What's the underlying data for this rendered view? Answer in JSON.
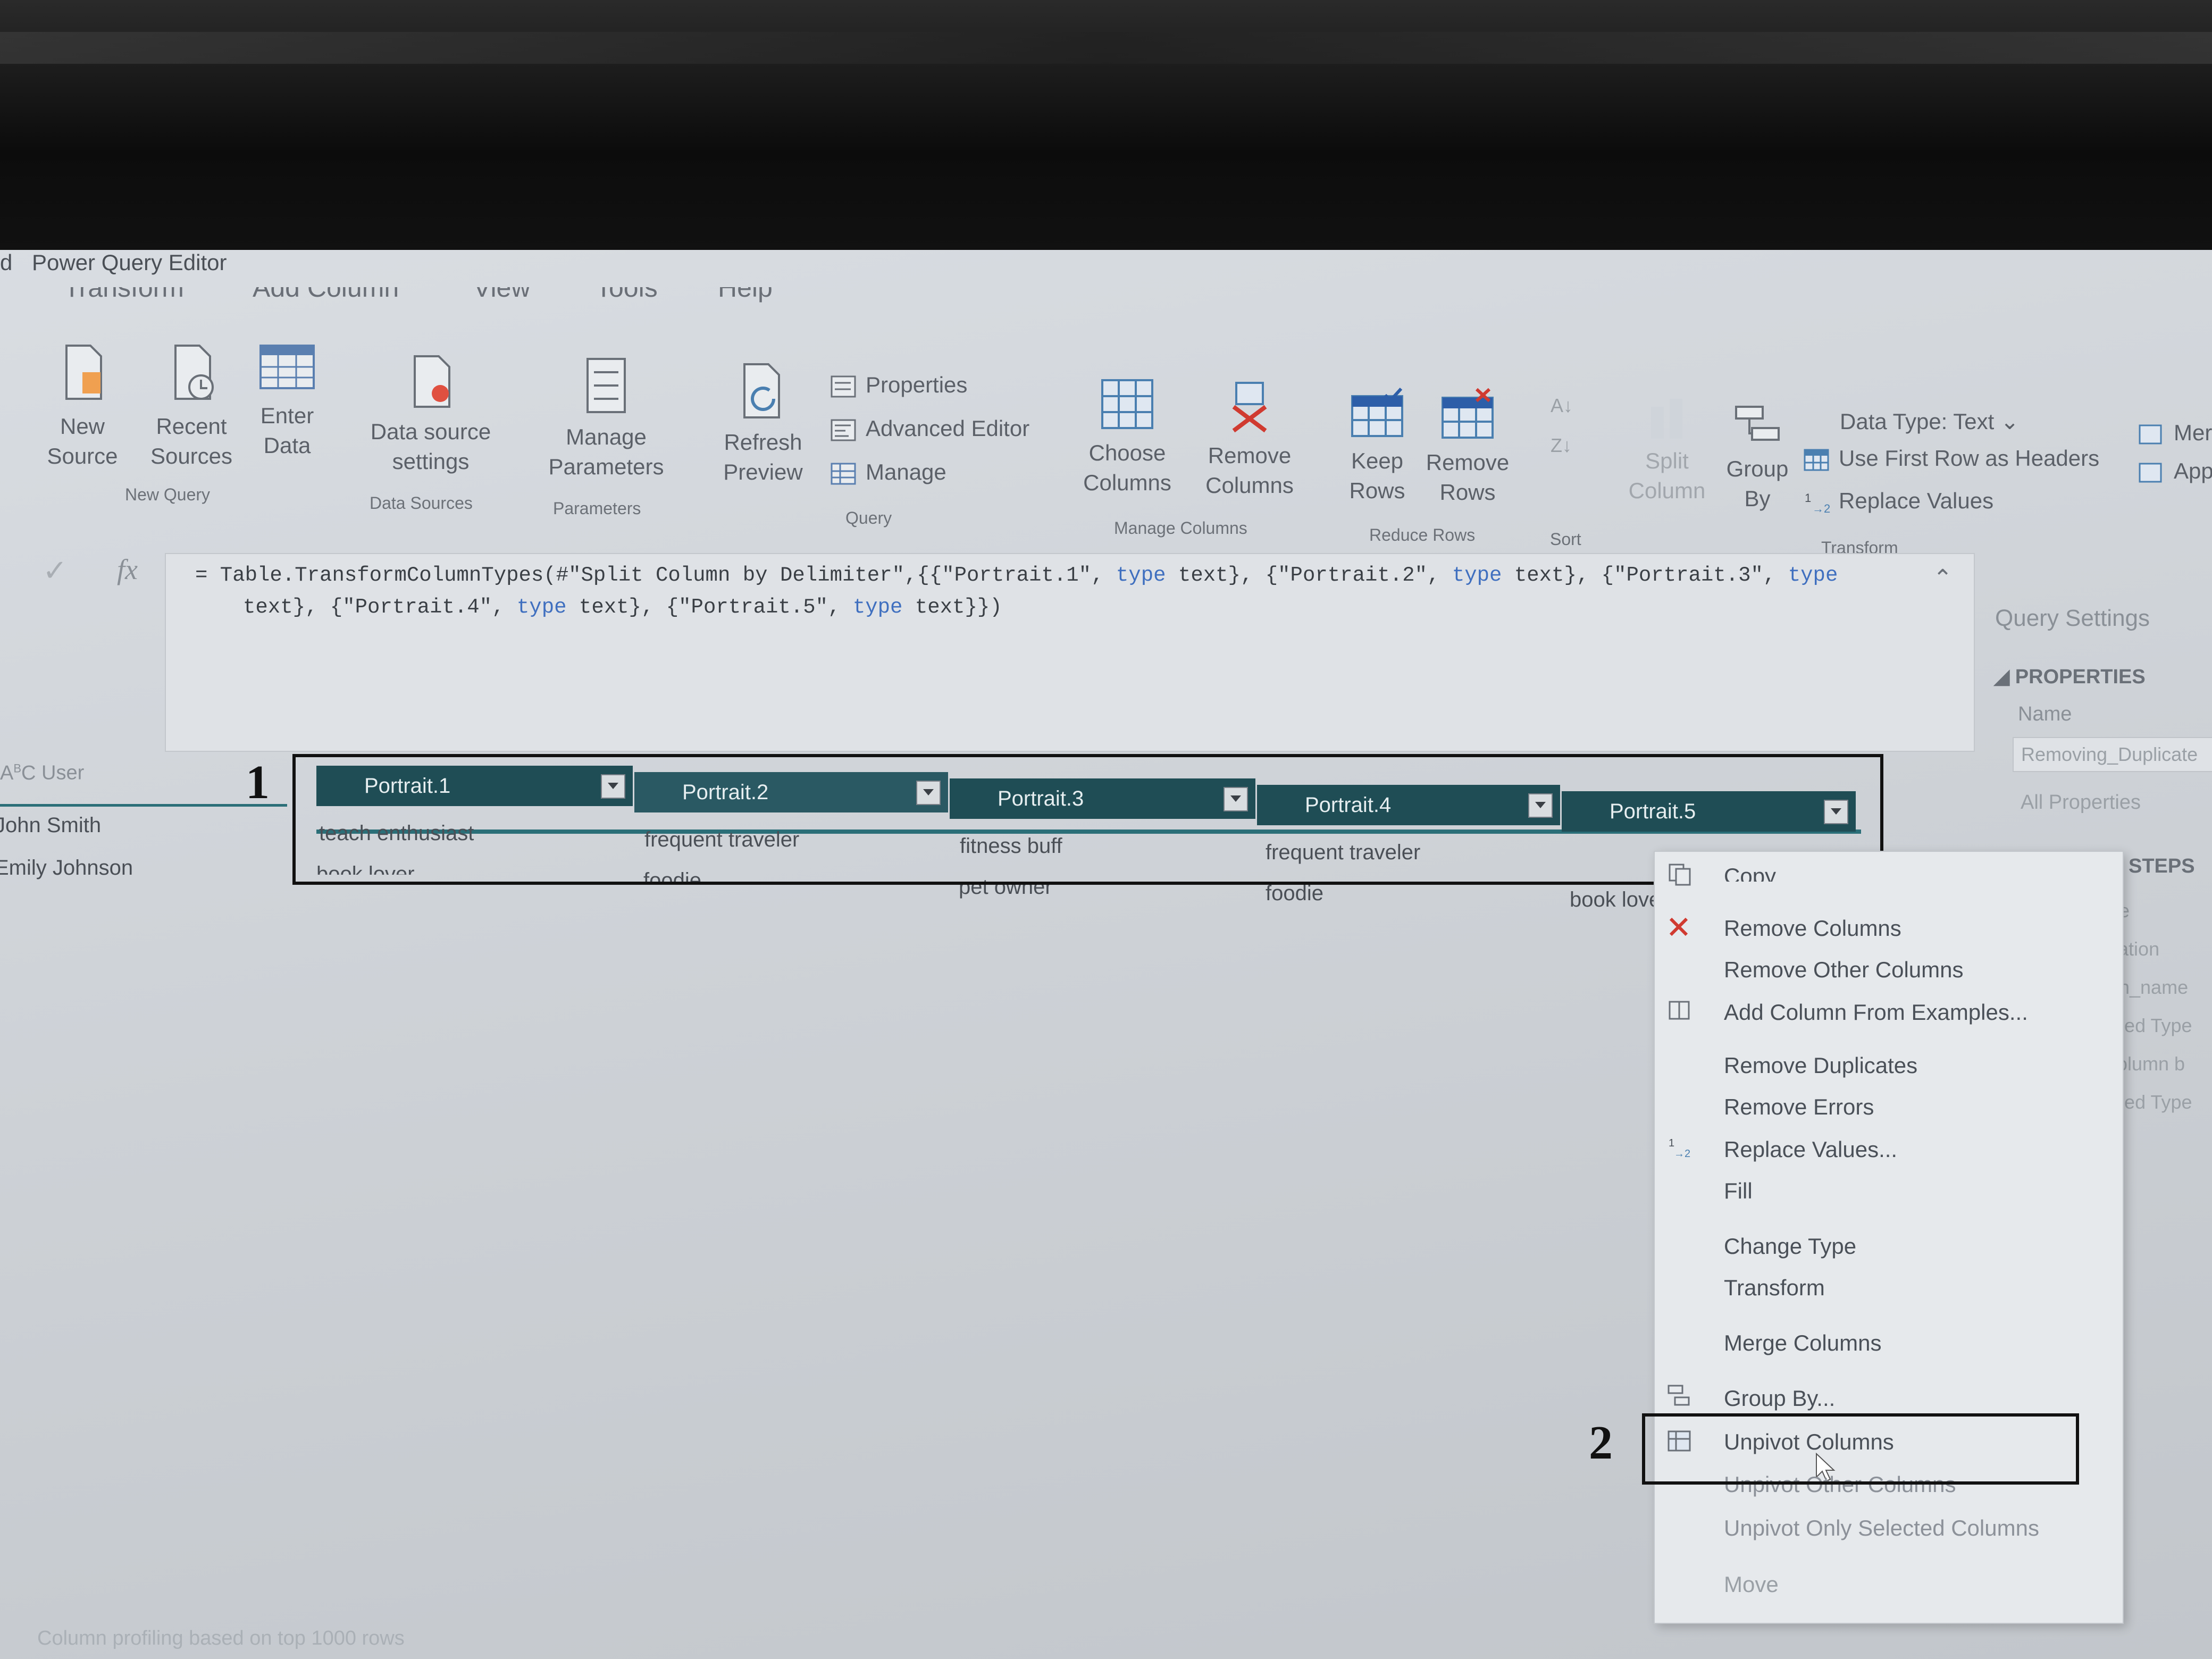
{
  "window": {
    "title": "Power Query Editor",
    "prefix": "d"
  },
  "tabs": [
    "Transform",
    "Add Column",
    "View",
    "Tools",
    "Help"
  ],
  "ribbon": {
    "new_source": "New Source",
    "recent_sources": "Recent Sources",
    "enter_data": "Enter Data",
    "group_new_query": "New Query",
    "data_source_settings": "Data source settings",
    "group_data_sources": "Data Sources",
    "manage_parameters": "Manage Parameters",
    "group_parameters": "Parameters",
    "refresh_preview": "Refresh Preview",
    "properties": "Properties",
    "advanced_editor": "Advanced Editor",
    "manage": "Manage",
    "group_query": "Query",
    "choose_columns": "Choose Columns",
    "remove_columns": "Remove Columns",
    "group_manage_columns": "Manage Columns",
    "keep_rows": "Keep Rows",
    "remove_rows": "Remove Rows",
    "group_reduce_rows": "Reduce Rows",
    "group_sort": "Sort",
    "split_column": "Split Column",
    "group_by": "Group By",
    "data_type": "Data Type: Text",
    "first_row_headers": "Use First Row as Headers",
    "replace_values": "Replace Values",
    "group_transform": "Transform",
    "merge_partial": "Mer",
    "append_partial": "App"
  },
  "formula": {
    "line1_prefix": "= Table.TransformColumnTypes(#\"Split Column by Delimiter\",{{\"Portrait.1\", ",
    "line1_mid": " text}, {\"Portrait.2\", ",
    "line1_mid2": " text}, {\"Portrait.3\", ",
    "line2_a": "text}, {\"Portrait.4\", ",
    "line2_b": " text}, {\"Portrait.5\", ",
    "line2_c": " text}})",
    "kw": "type"
  },
  "settings": {
    "title": "Query Settings",
    "properties": "PROPERTIES",
    "name_label": "Name",
    "name_value": "Removing_Duplicate",
    "all_properties": "All Properties",
    "applied_steps": "D STEPS",
    "steps": [
      "rce",
      "igation",
      "mn_name",
      "nged Type",
      "Column b",
      "nged Type"
    ]
  },
  "grid": {
    "first_col": "User",
    "users": [
      "John Smith",
      "Emily Johnson"
    ],
    "columns": [
      "Portrait.1",
      "Portrait.2",
      "Portrait.3",
      "Portrait.4",
      "Portrait.5"
    ],
    "row1": [
      "teach enthusiast",
      "frequent traveler",
      "fitness buff",
      "frequent traveler"
    ],
    "row2": [
      "book lover",
      "foodie",
      "pet owner",
      "foodie",
      "book love"
    ]
  },
  "context_menu": [
    "Copy",
    "Remove Columns",
    "Remove Other Columns",
    "Add Column From Examples...",
    "Remove Duplicates",
    "Remove Errors",
    "Replace Values...",
    "Fill",
    "Change Type",
    "Transform",
    "Merge Columns",
    "Group By...",
    "Unpivot Columns",
    "Unpivot Other Columns",
    "Unpivot Only Selected Columns",
    "Move"
  ],
  "annotations": {
    "one": "1",
    "two": "2"
  },
  "status": "Column profiling based on top 1000 rows",
  "colors": {
    "header_bg": "#1f4d55",
    "keyword": "#3f6fbf",
    "annotation": "#111111"
  }
}
